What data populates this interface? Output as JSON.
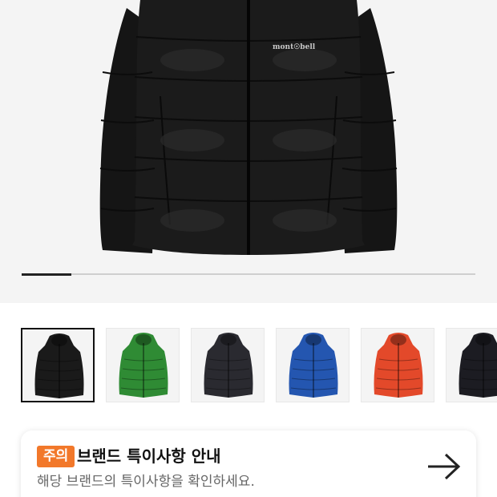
{
  "hero": {
    "brand_logo_text": "mont☉bell",
    "slide_progress": 0.11
  },
  "thumbnails": [
    {
      "color": "#1a1a1a",
      "selected": true
    },
    {
      "color": "#2f8b34",
      "selected": false
    },
    {
      "color": "#2a2a30",
      "selected": false
    },
    {
      "color": "#2456b0",
      "selected": false
    },
    {
      "color": "#e3492a",
      "selected": false
    },
    {
      "color": "#1c1c22",
      "selected": false
    }
  ],
  "notice": {
    "badge": "주의",
    "title": "브랜드 특이사항 안내",
    "subtitle": "해당 브랜드의 특이사항을 확인하세요."
  }
}
